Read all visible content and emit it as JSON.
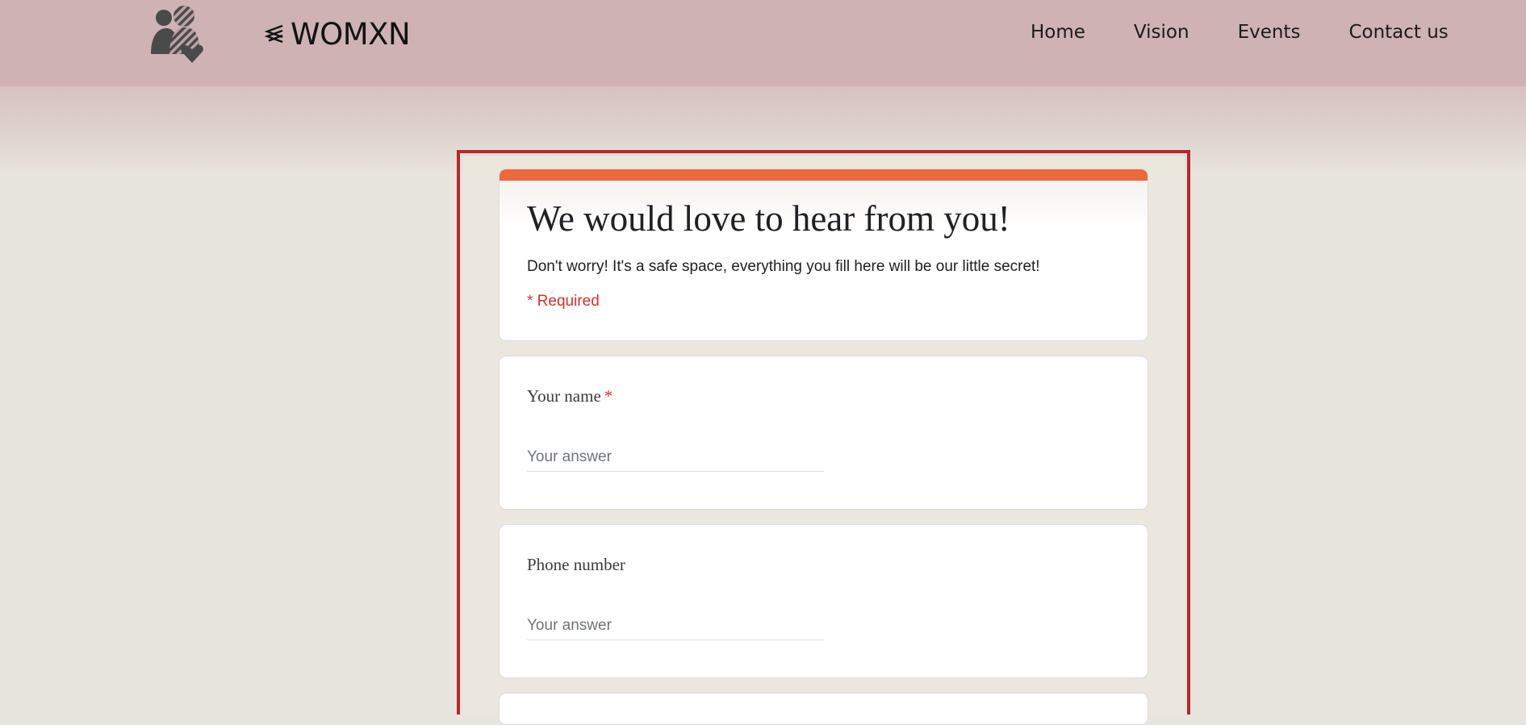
{
  "header": {
    "brand_text": "WOMXN",
    "nav": [
      {
        "label": "Home"
      },
      {
        "label": "Vision"
      },
      {
        "label": "Events"
      },
      {
        "label": "Contact us"
      }
    ]
  },
  "form": {
    "title": "We would love to hear from you!",
    "description": "Don't worry! It's a safe space, everything you fill here will be our little secret!",
    "required_note": "* Required",
    "questions": [
      {
        "label": "Your name",
        "required_marker": "*",
        "placeholder": "Your answer",
        "value": ""
      },
      {
        "label": "Phone number",
        "placeholder": "Your answer",
        "value": ""
      }
    ]
  },
  "icons": {
    "logo": "women-heart-logo-icon",
    "brand": "chevron-stack-icon"
  },
  "colors": {
    "navbar": "#ceb2b4",
    "page_background": "#e8e5dd",
    "frame_border": "#b5282d",
    "form_accent": "#ec683d",
    "required": "#d93025"
  }
}
